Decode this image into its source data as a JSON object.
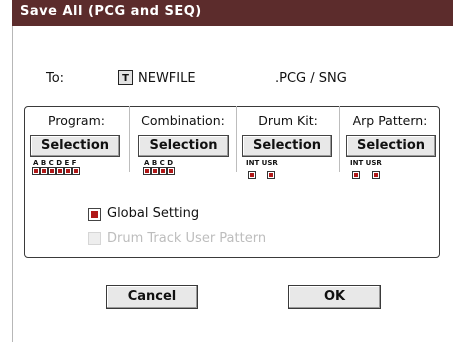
{
  "dialog": {
    "title": "Save All (PCG and SEQ)"
  },
  "to": {
    "label": "To:",
    "text_edit_icon": "T",
    "filename": "NEWFILE",
    "extension": ".PCG / SNG"
  },
  "columns": [
    {
      "label": "Program:",
      "button": "Selection",
      "bank_labels": "A B C D E F",
      "banks": [
        true,
        true,
        true,
        true,
        true,
        true
      ]
    },
    {
      "label": "Combination:",
      "button": "Selection",
      "bank_labels": "A B C D",
      "banks": [
        true,
        true,
        true,
        true
      ]
    },
    {
      "label": "Drum Kit:",
      "button": "Selection",
      "bank_labels": "INT USR",
      "banks": [
        true,
        true
      ]
    },
    {
      "label": "Arp Pattern:",
      "button": "Selection",
      "bank_labels": "INT USR",
      "banks": [
        true,
        true
      ]
    }
  ],
  "options": {
    "global_setting": {
      "label": "Global Setting",
      "checked": true,
      "enabled": true
    },
    "drum_track_user_pattern": {
      "label": "Drum Track User Pattern",
      "checked": false,
      "enabled": false
    }
  },
  "buttons": {
    "cancel": "Cancel",
    "ok": "OK"
  },
  "colors": {
    "title_bar": "#5c2c2c",
    "check_fill": "#b01818"
  }
}
